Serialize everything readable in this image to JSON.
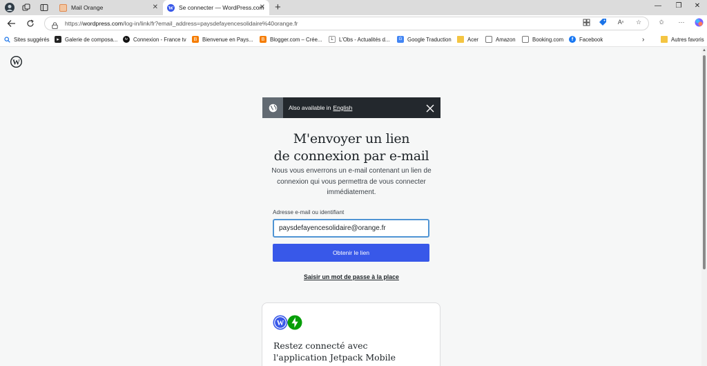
{
  "browser": {
    "tabs": [
      {
        "title": "Mail Orange",
        "active": false
      },
      {
        "title": "Se connecter — WordPress.com",
        "active": true
      }
    ],
    "url_prefix": "https://",
    "url_domain": "wordpress.com",
    "url_path": "/log-in/link/fr?email_address=paysdefayencesolidaire%40orange.fr",
    "bookmarks": [
      "Sites suggérés",
      "Galerie de composa...",
      "Connexion - France tv",
      "Bienvenue en Pays...",
      "Blogger.com – Crée...",
      "L'Obs - Actualités d...",
      "Google Traduction",
      "Acer",
      "Amazon",
      "Booking.com",
      "Facebook"
    ],
    "other_favorites": "Autres favoris"
  },
  "notice": {
    "text": "Also available in",
    "link": "English"
  },
  "login": {
    "heading_line1": "M'envoyer un lien",
    "heading_line2": "de connexion par e-mail",
    "description": "Nous vous enverrons un e-mail contenant un lien de connexion qui vous permettra de vous connecter immédiatement.",
    "email_label": "Adresse e-mail ou identifiant",
    "email_value": "paysdefayencesolidaire@orange.fr",
    "submit_label": "Obtenir le lien",
    "password_link": "Saisir un mot de passe à la place"
  },
  "jetpack": {
    "title": "Restez connecté avec l'application Jetpack Mobile"
  },
  "colors": {
    "primary": "#3858e9",
    "notice_bg": "#23282d",
    "focus_border": "#4f94d4",
    "jetpack_green": "#069e08"
  }
}
